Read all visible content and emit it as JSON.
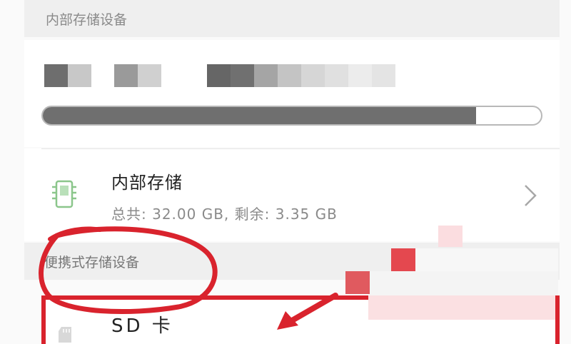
{
  "internal_section": {
    "header": "内部存储设备",
    "usage_fraction": 0.87
  },
  "internal_storage": {
    "title": "内部存储",
    "subtitle": "总共: 32.00 GB, 剩余: 3.35 GB",
    "chevron_icon": "chevron-right-icon",
    "chip_icon": "chip-icon",
    "icon_color": "#8bc68b"
  },
  "portable_section": {
    "header": "便携式存储设备"
  },
  "sd_card": {
    "title": "SD 卡",
    "icon": "sd-card-icon"
  },
  "annotation_color": "#d9232d"
}
